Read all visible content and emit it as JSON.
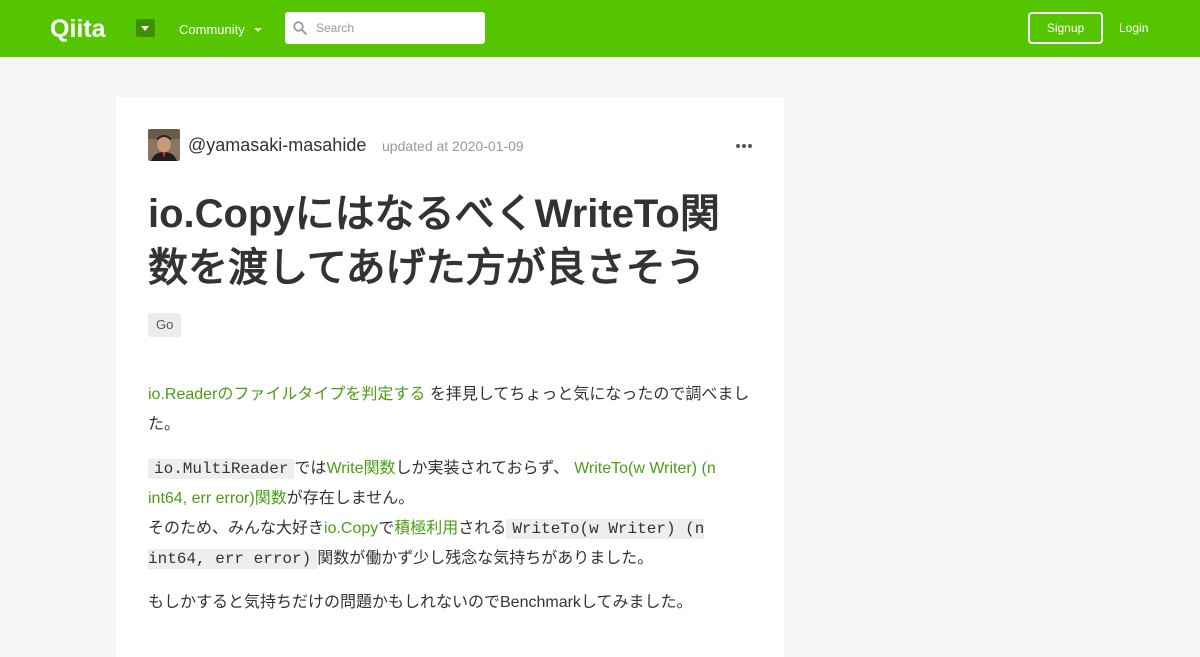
{
  "header": {
    "logo_text": "Qiita",
    "community_label": "Community",
    "search": {
      "placeholder": "Search",
      "value": ""
    },
    "signup_label": "Signup",
    "login_label": "Login",
    "brand_color": "#55c500"
  },
  "article": {
    "author": "@yamasaki-masahide",
    "updated": "updated at 2020-01-09",
    "title": "io.CopyにはなるべくWriteTo関数を渡してあげた方が良さそう",
    "tags": [
      "Go"
    ],
    "p1": {
      "link": "io.Readerのファイルタイプを判定する",
      "text": " を拝見してちょっと気になったので調べました。"
    },
    "p2": {
      "code1": "io.MultiReader",
      "t1": "では",
      "link1": "Write関数",
      "t2": "しか実装されておらず、",
      "link2": "WriteTo(w Writer) (n int64, err error)関数",
      "t3": "が存在しません。",
      "t4": "そのため、みんな大好き",
      "link3": "io.Copy",
      "t5": "で",
      "link4": "積極利用",
      "t6": "される",
      "code2": "WriteTo(w Writer) (n int64, err error)",
      "t7": "関数が働かず少し残念な気持ちがありました。"
    },
    "p3": {
      "text": "もしかすると気持ちだけの問題かもしれないのでBenchmarkしてみました。"
    }
  }
}
